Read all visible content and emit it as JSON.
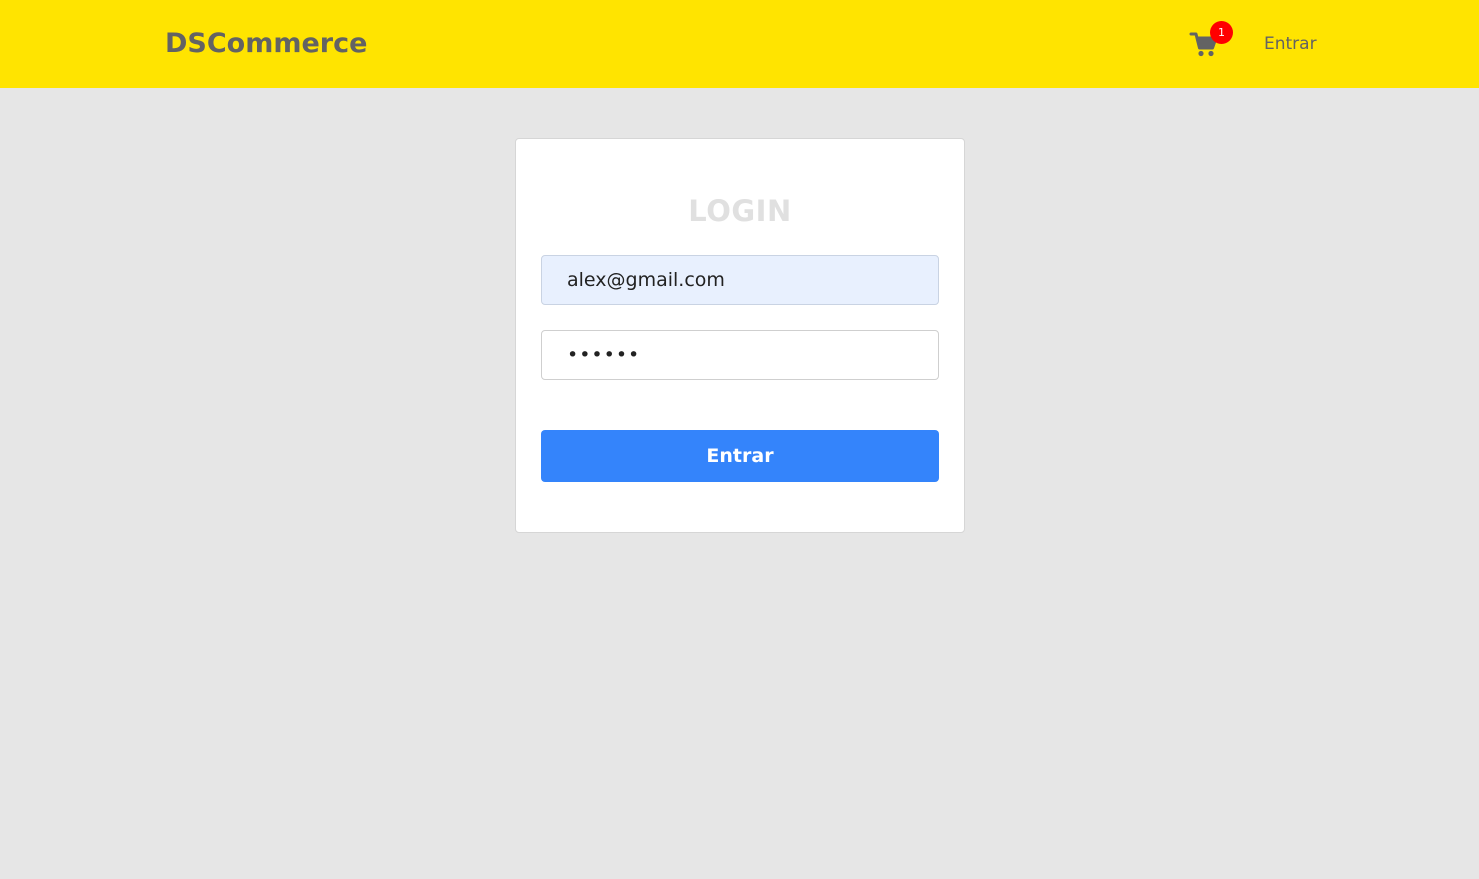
{
  "header": {
    "brand": "DSCommerce",
    "cart_icon": "shopping-cart-icon",
    "cart_count": "1",
    "login_link": "Entrar"
  },
  "login": {
    "title": "LOGIN",
    "email_value": "alex@gmail.com",
    "password_value": "123456",
    "submit_label": "Entrar"
  },
  "colors": {
    "header_bg": "#ffe400",
    "page_bg": "#e6e6e6",
    "primary_button": "#3484fb",
    "badge": "#ff0000",
    "text_gray": "#636363"
  }
}
